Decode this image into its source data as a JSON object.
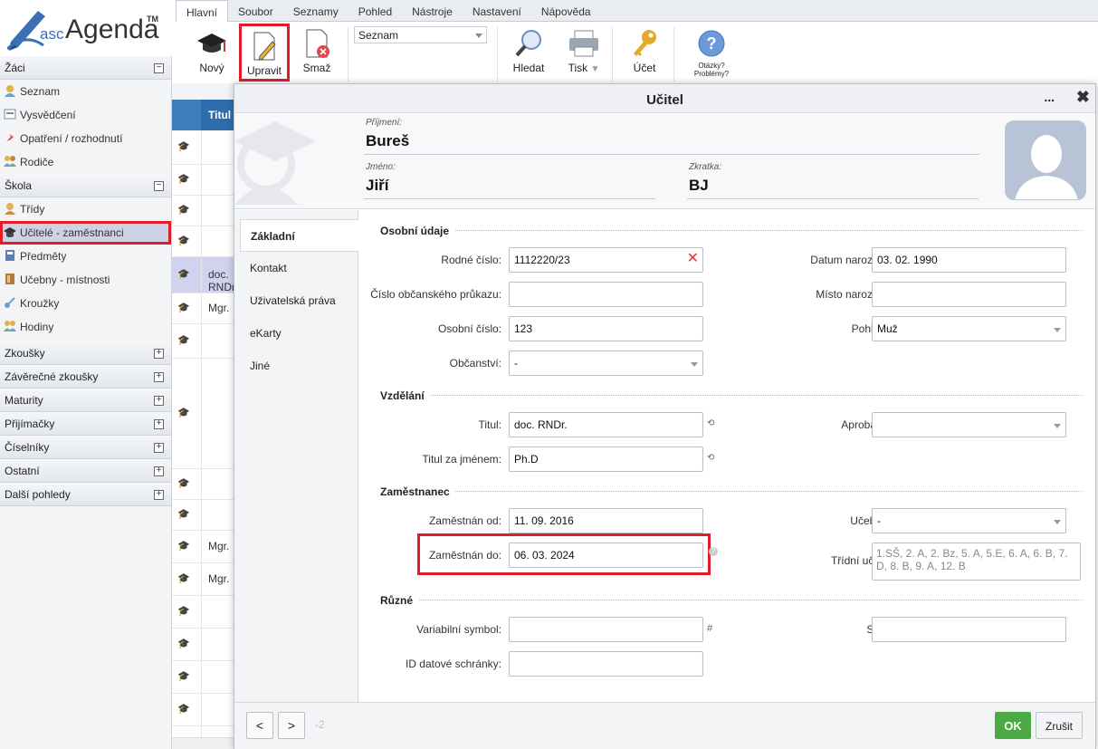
{
  "app": {
    "logo_prefix": "asc",
    "logo_name": "Agenda",
    "logo_tm": "TM"
  },
  "menu_tabs": [
    "Hlavní",
    "Soubor",
    "Seznamy",
    "Pohled",
    "Nástroje",
    "Nastavení",
    "Nápověda"
  ],
  "toolbar": {
    "new_label": "Nový",
    "edit_label": "Upravit",
    "delete_label": "Smaž",
    "view_select_value": "Seznam",
    "find_label": "Hledat",
    "print_label": "Tisk",
    "account_label": "Účet",
    "help_label_line1": "Otázky?",
    "help_label_line2": "Problémy?"
  },
  "sidebar": {
    "sections": [
      {
        "label": "Žáci",
        "expanded": true,
        "items": [
          "Seznam",
          "Vysvědčení",
          "Opatření / rozhodnutí",
          "Rodiče"
        ]
      },
      {
        "label": "Škola",
        "expanded": true,
        "items": [
          "Třídy",
          "Učitelé - zaměstnanci",
          "Předměty",
          "Učebny - místnosti",
          "Kroužky",
          "Hodiny"
        ]
      },
      {
        "label": "Zkoušky",
        "expanded": false
      },
      {
        "label": "Závěrečné zkoušky",
        "expanded": false
      },
      {
        "label": "Maturity",
        "expanded": false
      },
      {
        "label": "Přijímačky",
        "expanded": false
      },
      {
        "label": "Číselníky",
        "expanded": false
      },
      {
        "label": "Ostatní",
        "expanded": false
      },
      {
        "label": "Další pohledy",
        "expanded": false
      }
    ],
    "selected_item": "Učitelé - zaměstnanci"
  },
  "grid": {
    "header": "Titul",
    "rows": [
      "",
      "",
      "",
      "",
      "doc. RNDr.",
      "Mgr.",
      "",
      "",
      "",
      "",
      "Mgr.",
      "Mgr.",
      "",
      "",
      "",
      ""
    ]
  },
  "dialog": {
    "title": "Učitel",
    "more_symbol": "...",
    "close_symbol": "✖",
    "surname_label": "Příjmení:",
    "surname": "Bureš",
    "firstname_label": "Jméno:",
    "firstname": "Jiří",
    "abbr_label": "Zkratka:",
    "abbr": "BJ",
    "tabs": [
      "Základní",
      "Kontakt",
      "Uživatelská práva",
      "eKarty",
      "Jiné"
    ],
    "active_tab": "Základní",
    "sections": {
      "personal": "Osobní údaje",
      "education": "Vzdělání",
      "employee": "Zaměstnanec",
      "misc": "Různé"
    },
    "fields": {
      "birth_number": {
        "label": "Rodné číslo:",
        "value": "1112220/23"
      },
      "birth_date": {
        "label": "Datum narození:",
        "value": "03. 02. 1990"
      },
      "id_card": {
        "label": "Číslo občanského průkazu:",
        "value": ""
      },
      "birth_place": {
        "label": "Místo narození:",
        "value": ""
      },
      "personal_number": {
        "label": "Osobní číslo:",
        "value": "123"
      },
      "gender": {
        "label": "Pohlaví:",
        "value": "Muž"
      },
      "citizenship": {
        "label": "Občanství:",
        "value": "-"
      },
      "title": {
        "label": "Titul:",
        "value": "doc. RNDr."
      },
      "approbation": {
        "label": "Aprobace:",
        "value": ""
      },
      "title_after": {
        "label": "Titul za jménem:",
        "value": "Ph.D"
      },
      "employed_from": {
        "label": "Zaměstnán od:",
        "value": "11. 09. 2016"
      },
      "classroom": {
        "label": "Učebna:",
        "value": "-"
      },
      "employed_to": {
        "label": "Zaměstnán do:",
        "value": "06. 03. 2024"
      },
      "class_teacher": {
        "label": "Třídní učitel:",
        "value": "1.SŠ, 2. A, 2. Bz, 5. A, 5.E, 6. A, 6. B, 7. D, 8. B, 9. A, 12. B"
      },
      "variable_symbol": {
        "label": "Variabilní symbol:",
        "value": "",
        "side": "#"
      },
      "spz": {
        "label": "SPZ:",
        "value": ""
      },
      "databox_id": {
        "label": "ID datové schránky:",
        "value": ""
      }
    },
    "footer": {
      "prev": "<",
      "next": ">",
      "index": "-2",
      "ok": "OK",
      "cancel": "Zrušit"
    }
  },
  "colors": {
    "accent_red": "#e21c2a",
    "ok_green": "#4caa44",
    "grid_header": "#2d6dad",
    "selected_row": "#cfd3ee"
  }
}
